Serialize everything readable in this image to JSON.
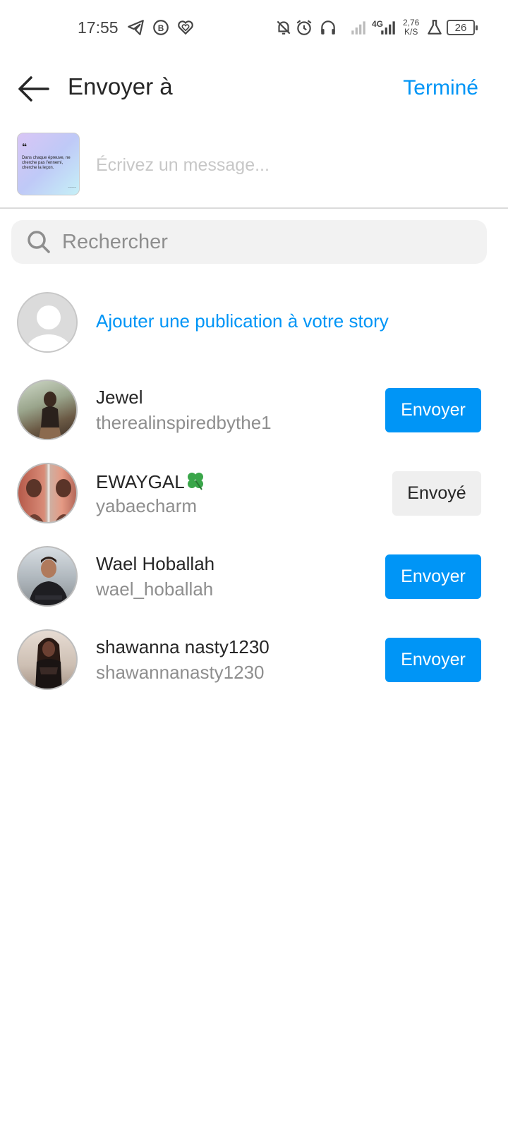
{
  "status_bar": {
    "time": "17:55",
    "net_speed_value": "2,76",
    "net_speed_unit": "K/S",
    "network_type": "4G",
    "battery_level": "26",
    "icons": [
      "telegram-icon",
      "whatsapp-business-icon",
      "heart-app-icon",
      "notifications-off-icon",
      "alarm-icon",
      "headphones-icon",
      "signal-icon",
      "signal-4g-icon",
      "flask-icon",
      "battery-icon"
    ]
  },
  "header": {
    "title": "Envoyer à",
    "done_label": "Terminé"
  },
  "share": {
    "thumb_quote_mark": "❝",
    "thumb_text": "Dans chaque épreuve, ne cherche pas l'ennemi, cherche la leçon.",
    "message_placeholder": "Écrivez un message..."
  },
  "search": {
    "placeholder": "Rechercher"
  },
  "story": {
    "label": "Ajouter une publication à votre story"
  },
  "contacts": [
    {
      "name": "Jewel",
      "username": "therealinspiredbythe1",
      "button": "Envoyer",
      "state": "send"
    },
    {
      "name": "EWAYGAL",
      "username": "yabaecharm",
      "button": "Envoyé",
      "state": "sent"
    },
    {
      "name": "Wael Hoballah",
      "username": "wael_hoballah",
      "button": "Envoyer",
      "state": "send"
    },
    {
      "name": "shawanna nasty1230",
      "username": "shawannanasty1230",
      "button": "Envoyer",
      "state": "send"
    }
  ],
  "colors": {
    "accent": "#0095f6",
    "sent_button_bg": "#efefef",
    "secondary_text": "#8e8e8e"
  }
}
